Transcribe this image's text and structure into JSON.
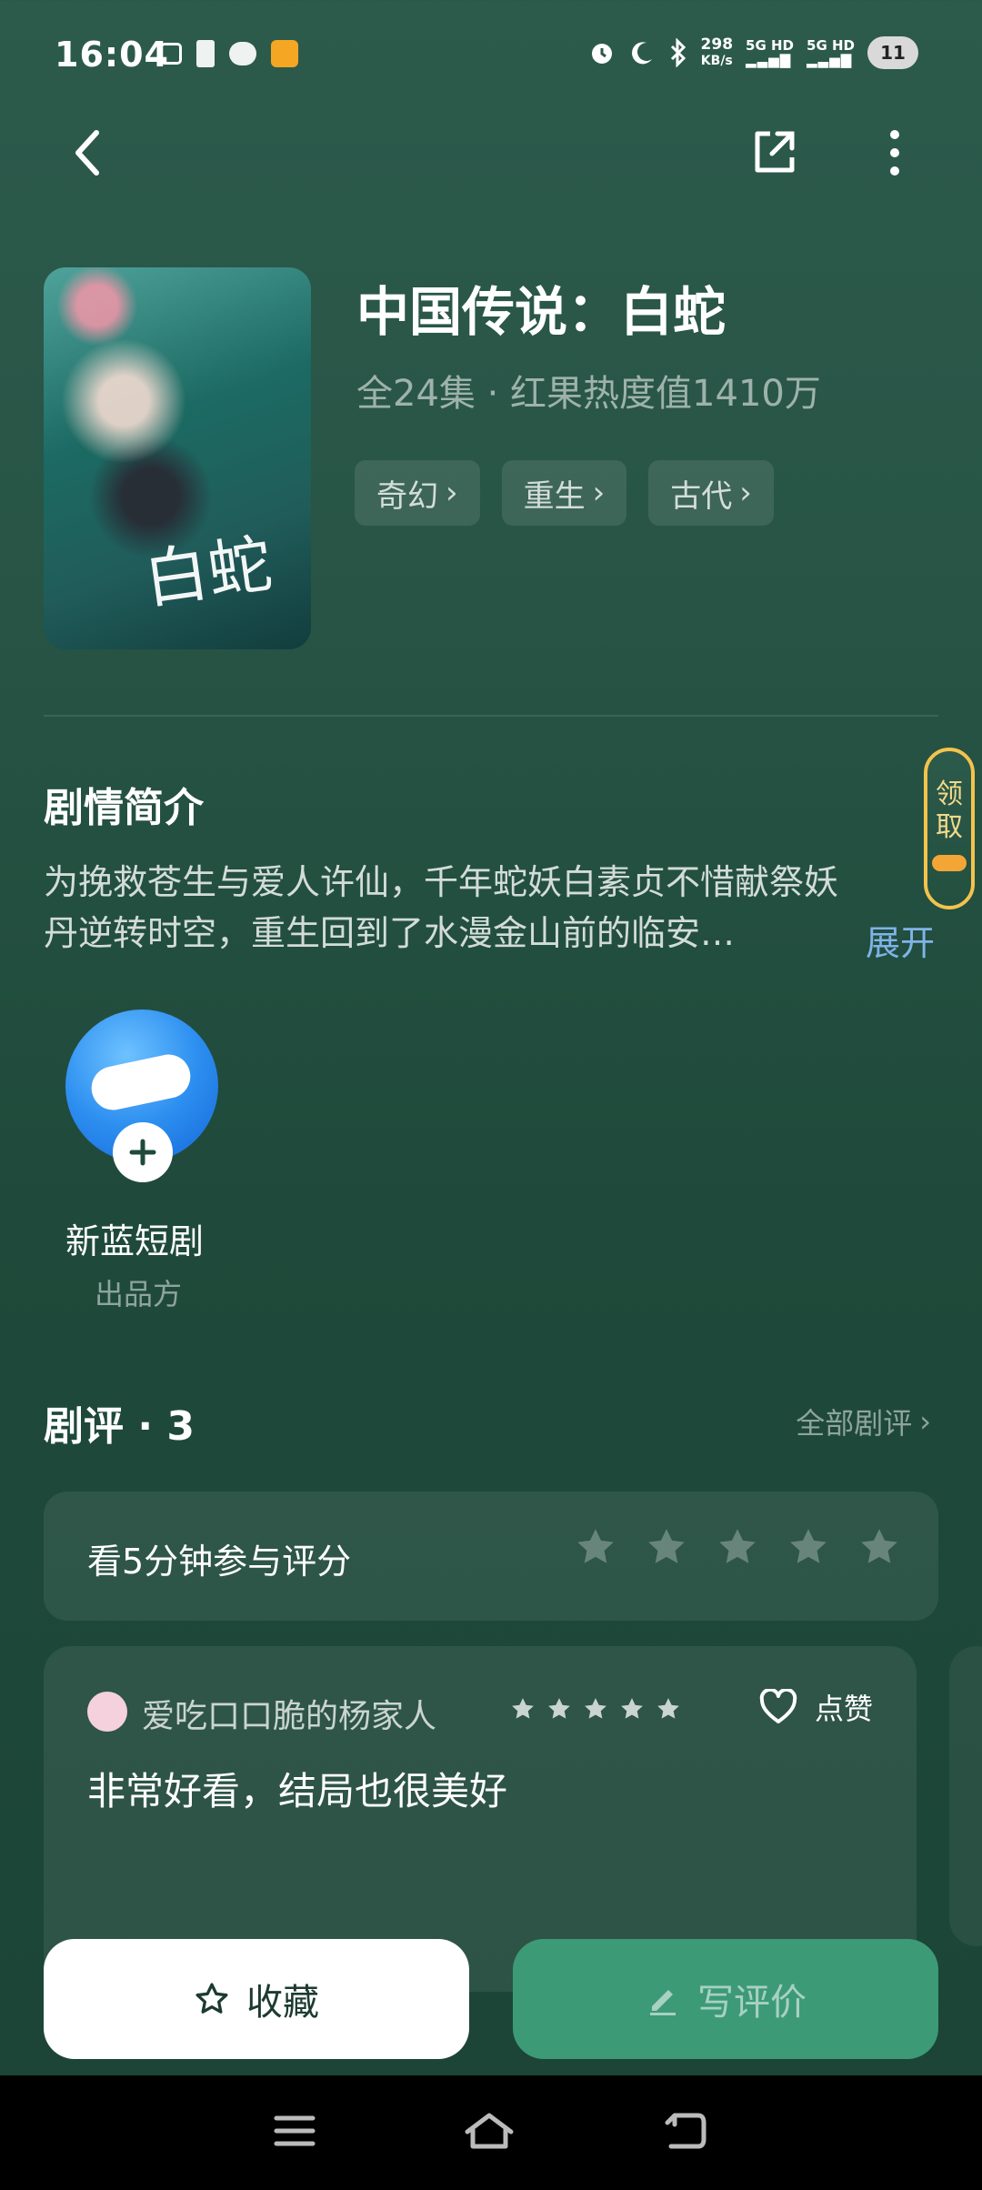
{
  "status_bar": {
    "time": "16:04",
    "net_speed_value": "298",
    "net_speed_unit": "KB/s",
    "sim1": "5G HD",
    "sim2": "5G HD",
    "battery": "11",
    "left_icons": [
      "tv-icon",
      "sim-card-icon",
      "wechat-icon",
      "weibo-icon"
    ],
    "right_icons": [
      "alarm-icon",
      "moon-icon",
      "bluetooth-icon"
    ]
  },
  "nav": {
    "back_icon": "chevron-left-icon",
    "share_icon": "share-icon",
    "more_icon": "more-vertical-icon"
  },
  "drama": {
    "poster_title": "白蛇",
    "title": "中国传说：白蛇",
    "meta": "全24集 · 红果热度值1410万",
    "tags": [
      "奇幻",
      "重生",
      "古代"
    ]
  },
  "synopsis": {
    "heading": "剧情简介",
    "line1": "为挽救苍生与爱人许仙，千年蛇妖白素贞不惜献祭妖",
    "line2": "丹逆转时空，重生回到了水漫金山前的临安…",
    "expand": "展开"
  },
  "claim": {
    "label1": "领",
    "label2": "取"
  },
  "producer": {
    "name": "新蓝短剧",
    "role": "出品方"
  },
  "reviews": {
    "heading": "剧评 · 3",
    "all_label": "全部剧评",
    "rate_prompt": "看5分钟参与评分",
    "rate_star_count": 5,
    "items": [
      {
        "user": "爱吃口口脆的杨家人",
        "rating": 5,
        "like_label": "点赞",
        "text": "非常好看，结局也很美好"
      }
    ]
  },
  "actions": {
    "favorite": "收藏",
    "write_review": "写评价"
  },
  "colors": {
    "background": "#285546",
    "accent": "#3d9a77",
    "expand_link": "#7fb4e8",
    "claim_border": "#f3c34d"
  }
}
